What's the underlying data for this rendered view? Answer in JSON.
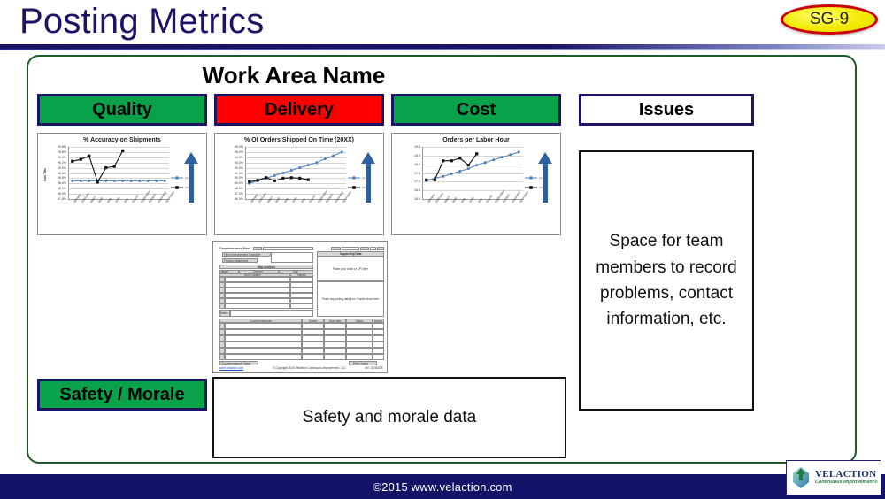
{
  "header": {
    "title": "Posting Metrics",
    "badge": "SG-9"
  },
  "board": {
    "work_area_title": "Work Area Name",
    "chips": {
      "quality": "Quality",
      "delivery": "Delivery",
      "cost": "Cost",
      "issues": "Issues",
      "safety": "Safety / Morale"
    },
    "issues_text": "Space for team members to record problems, contact information, etc.",
    "safety_text": "Safety and morale data"
  },
  "colors": {
    "navy": "#1b1464",
    "green": "#0aa14b",
    "red": "#fe0000",
    "frame_green": "#1d5b2a",
    "series_goal": "#4a7ebb",
    "series_actual": "#111111",
    "badge_fill": "#f2e800",
    "badge_border": "#cc0000"
  },
  "months": [
    "January",
    "February",
    "March",
    "April",
    "May",
    "June",
    "July",
    "August",
    "September",
    "October",
    "November",
    "December"
  ],
  "legend": {
    "goal": "Goal",
    "actual": "Actual"
  },
  "chart_data": [
    {
      "id": "quality",
      "type": "line",
      "title": "% Accuracy on Shipments",
      "xlabel": "",
      "ylabel": "Axis Title",
      "ylim": [
        97.8,
        99.8
      ],
      "ytick_labels": [
        "99.8%",
        "99.6%",
        "99.4%",
        "99.2%",
        "99.0%",
        "98.8%",
        "98.6%",
        "98.4%",
        "98.2%",
        "98.0%",
        "97.8%"
      ],
      "categories": [
        "January",
        "February",
        "March",
        "April",
        "May",
        "June",
        "July",
        "August",
        "September",
        "October",
        "November",
        "December"
      ],
      "grid": true,
      "legend_position": "right",
      "series": [
        {
          "name": "Goal",
          "color": "#4a7ebb",
          "values": [
            98.5,
            98.5,
            98.5,
            98.5,
            98.5,
            98.5,
            98.5,
            98.5,
            98.5,
            98.5,
            98.5,
            98.5
          ]
        },
        {
          "name": "Actual",
          "color": "#111111",
          "values": [
            99.25,
            99.32,
            99.45,
            98.45,
            99.0,
            99.05,
            99.65,
            null,
            null,
            null,
            null,
            null
          ]
        }
      ]
    },
    {
      "id": "delivery",
      "type": "line",
      "title": "% Of Orders Shipped On Time (20XX)",
      "xlabel": "",
      "ylabel": "",
      "ylim": [
        86.0,
        96.0
      ],
      "ytick_labels": [
        "96.0%",
        "95.0%",
        "94.0%",
        "93.0%",
        "92.0%",
        "91.0%",
        "90.0%",
        "89.0%",
        "88.0%",
        "87.0%",
        "86.0%"
      ],
      "categories": [
        "January",
        "February",
        "March",
        "April",
        "May",
        "June",
        "July",
        "August",
        "September",
        "October",
        "November",
        "December"
      ],
      "grid": true,
      "legend_position": "right",
      "series": [
        {
          "name": "Goal",
          "color": "#4a7ebb",
          "values": [
            89.0,
            89.5,
            90.0,
            90.5,
            91.0,
            91.5,
            92.0,
            92.5,
            93.0,
            93.7,
            94.3,
            95.0
          ]
        },
        {
          "name": "Actual",
          "color": "#111111",
          "values": [
            89.3,
            89.6,
            90.1,
            89.5,
            90.0,
            90.1,
            90.0,
            89.7,
            null,
            null,
            null,
            null
          ]
        }
      ]
    },
    {
      "id": "cost",
      "type": "line",
      "title": "Orders per Labor Hour",
      "xlabel": "",
      "ylabel": "",
      "ylim": [
        16.0,
        19.0
      ],
      "ytick_labels": [
        "19.0",
        "18.5",
        "18.0",
        "17.5",
        "17.0",
        "16.5",
        "16.0"
      ],
      "categories": [
        "January",
        "February",
        "March",
        "April",
        "May",
        "June",
        "July",
        "August",
        "September",
        "October",
        "November",
        "December"
      ],
      "grid": true,
      "legend_position": "right",
      "series": [
        {
          "name": "Goal",
          "color": "#4a7ebb",
          "values": [
            17.05,
            17.2,
            17.3,
            17.45,
            17.6,
            17.75,
            17.95,
            18.1,
            18.25,
            18.4,
            18.55,
            18.7
          ]
        },
        {
          "name": "Actual",
          "color": "#111111",
          "values": [
            17.1,
            17.1,
            18.2,
            18.2,
            18.35,
            17.95,
            18.6,
            null,
            null,
            null,
            null,
            null
          ]
        }
      ]
    }
  ],
  "countermeasure_sheet": {
    "title": "Countermeasure Sheet",
    "fields": [
      "Area",
      "Date",
      "Page",
      "of"
    ],
    "buttons": [
      "Fill in Improvement Objective",
      "Problem Statement"
    ],
    "gap_analysis_title": "Gap Analysis",
    "gap_headers": [
      "Target",
      "Current",
      "Gap"
    ],
    "root_cause_header": "Root Causes",
    "impact_header": "Impact",
    "notes_label": "Notes",
    "supporting_data_title": "Supporting Data",
    "supporting_hint_1": "Paste your chart or KPI here",
    "supporting_hint_2": "Paste supporting data icon. Pareto chart here",
    "countermeasure_headers": [
      "Countermeasures",
      "Owner",
      "Due Date",
      "Status",
      "Impact"
    ],
    "footer_button": "Countermeasure Sheet",
    "footer_link": "www.velaction.com",
    "footer_copyright": "© Copyright 2015 Velaction Continuous Improvement, LLC",
    "print_button": "Print Output",
    "version": "Ver. 10252015"
  },
  "footer": {
    "copyright": "©2015  www.velaction.com",
    "logo_name": "VELACTION",
    "logo_tagline": "Continuous Improvement®"
  }
}
